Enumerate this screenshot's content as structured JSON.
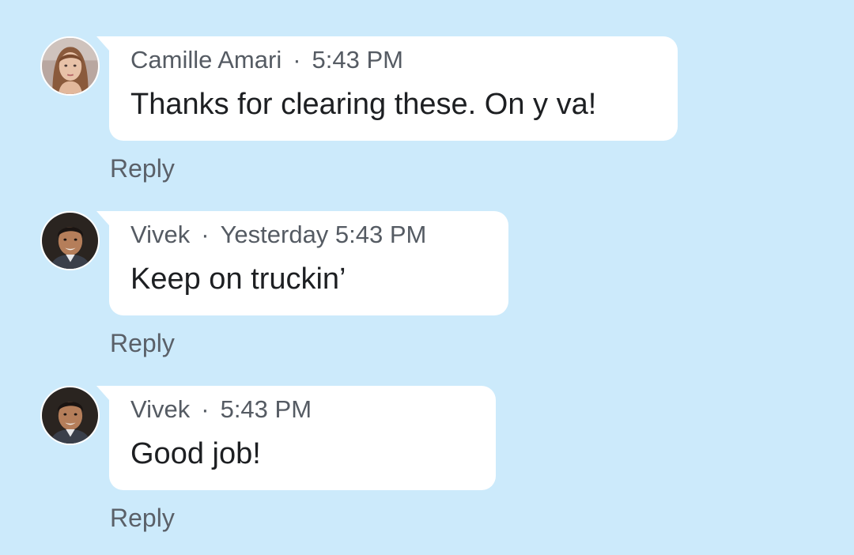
{
  "comments": [
    {
      "author": "Camille Amari",
      "separator": "·",
      "time": "5:43 PM",
      "text": "Thanks for clearing these. On y va!",
      "reply_label": "Reply",
      "avatar": "woman-portrait-avatar"
    },
    {
      "author": "Vivek",
      "separator": "·",
      "time": "Yesterday 5:43 PM",
      "text": "Keep on truckin’",
      "reply_label": "Reply",
      "avatar": "man-portrait-avatar"
    },
    {
      "author": "Vivek",
      "separator": "·",
      "time": "5:43 PM",
      "text": "Good job!",
      "reply_label": "Reply",
      "avatar": "man-portrait-avatar"
    }
  ],
  "colors": {
    "background": "#cceafb",
    "bubble": "#ffffff",
    "meta_text": "#555b63",
    "message_text": "#1d1f22"
  }
}
